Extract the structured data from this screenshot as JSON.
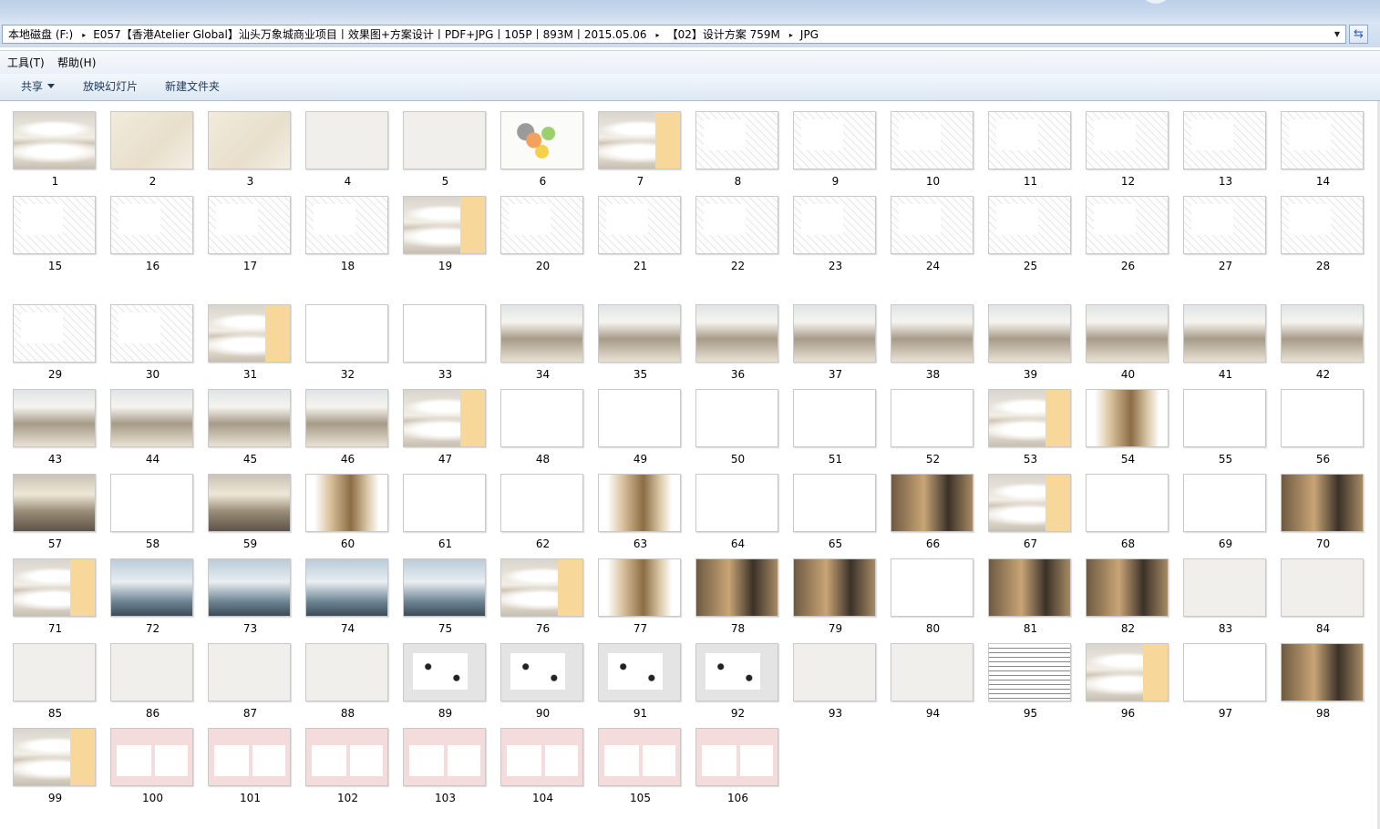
{
  "address_bar": {
    "crumbs": [
      "本地磁盘 (F:)",
      "E057【香港Atelier Global】汕头万象城商业项目丨效果图+方案设计丨PDF+JPG丨105P丨893M丨2015.05.06",
      "【02】设计方案 759M",
      "JPG"
    ],
    "separator": "▸",
    "dropdown_icon": "chevron-down-icon",
    "refresh_icon": "refresh-icon"
  },
  "menu": {
    "tools": "工具(T)",
    "help": "帮助(H)"
  },
  "toolbar": {
    "share": "共享",
    "slideshow": "放映幻灯片",
    "new_folder": "新建文件夹"
  },
  "files": [
    "1",
    "2",
    "3",
    "4",
    "5",
    "6",
    "7",
    "8",
    "9",
    "10",
    "11",
    "12",
    "13",
    "14",
    "15",
    "16",
    "17",
    "18",
    "19",
    "20",
    "21",
    "22",
    "23",
    "24",
    "25",
    "26",
    "27",
    "28",
    "29",
    "30",
    "31",
    "32",
    "33",
    "34",
    "35",
    "36",
    "37",
    "38",
    "39",
    "40",
    "41",
    "42",
    "43",
    "44",
    "45",
    "46",
    "47",
    "48",
    "49",
    "50",
    "51",
    "52",
    "53",
    "54",
    "55",
    "56",
    "57",
    "58",
    "59",
    "60",
    "61",
    "62",
    "63",
    "64",
    "65",
    "66",
    "67",
    "68",
    "69",
    "70",
    "71",
    "72",
    "73",
    "74",
    "75",
    "76",
    "77",
    "78",
    "79",
    "80",
    "81",
    "82",
    "83",
    "84",
    "85",
    "86",
    "87",
    "88",
    "89",
    "90",
    "91",
    "92",
    "93",
    "94",
    "95",
    "96",
    "97",
    "98",
    "99",
    "100",
    "101",
    "102",
    "103",
    "104",
    "105",
    "106"
  ],
  "thumb_styles": [
    "wave",
    "cream",
    "cream",
    "grey",
    "grey",
    "circ",
    "wavenum",
    "plan",
    "plan",
    "plan",
    "plan",
    "plan",
    "plan",
    "plan",
    "plan",
    "plan",
    "plan",
    "plan",
    "wavenum",
    "plan",
    "plan",
    "plan",
    "plan",
    "plan",
    "plan",
    "plan",
    "plan",
    "plan",
    "plan",
    "plan",
    "wavenum",
    "white",
    "white",
    "mall",
    "mall",
    "mall",
    "mall",
    "mall",
    "mall",
    "mall",
    "mall",
    "mall",
    "mall",
    "mall",
    "mall",
    "mall",
    "wavenum",
    "white",
    "white",
    "white",
    "white",
    "white",
    "wavenum",
    "wood",
    "white",
    "white",
    "photo",
    "white",
    "photo",
    "wood",
    "white",
    "white",
    "wood",
    "white",
    "white",
    "dark",
    "wavenum",
    "white",
    "white",
    "dark",
    "wavenum",
    "blue",
    "blue",
    "blue",
    "blue",
    "wavenum",
    "wood",
    "dark",
    "dark",
    "white",
    "dark",
    "dark",
    "grey",
    "grey",
    "grey",
    "grey",
    "grey",
    "grey",
    "bw",
    "bw",
    "bw",
    "bw",
    "grey",
    "grey",
    "table",
    "wavenum",
    "white",
    "dark",
    "wavenum",
    "red",
    "red",
    "red",
    "red",
    "red",
    "red",
    "red"
  ]
}
